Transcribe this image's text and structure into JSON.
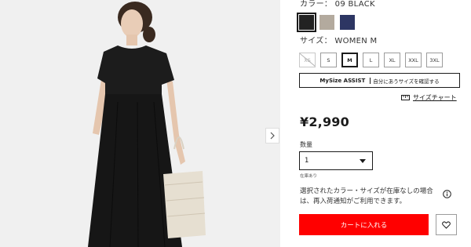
{
  "product": {
    "color_label": "カラー： 09 BLACK",
    "colors": [
      {
        "name": "black",
        "hex": "#222222",
        "selected": true
      },
      {
        "name": "beige",
        "hex": "#b3aa9e",
        "selected": false
      },
      {
        "name": "navy",
        "hex": "#2d3663",
        "selected": false
      }
    ],
    "size_label": "サイズ： WOMEN M",
    "sizes": [
      {
        "label": "XS",
        "state": "unavailable"
      },
      {
        "label": "S",
        "state": "available"
      },
      {
        "label": "M",
        "state": "selected"
      },
      {
        "label": "L",
        "state": "available"
      },
      {
        "label": "XL",
        "state": "available"
      },
      {
        "label": "XXL",
        "state": "available"
      },
      {
        "label": "3XL",
        "state": "available"
      }
    ],
    "mysize": {
      "brand": "MySize ASSIST",
      "text": "自分にあうサイズを確認する"
    },
    "size_chart": "サイズチャート",
    "price": "¥2,990",
    "quantity_label": "数量",
    "quantity_value": "1",
    "stock_status": "在庫あり",
    "notice": "選択されたカラー・サイズが在庫なしの場合は、再入荷通知がご利用できます。",
    "add_to_cart": "カートに入れる"
  },
  "icons": {
    "next": "chevron-right-icon",
    "info": "info-icon",
    "favorite": "heart-icon",
    "size_chart": "ruler-icon"
  },
  "colors": {
    "accent": "#ff0000",
    "text": "#1b1b1b",
    "image_bg": "#f0f0f0"
  }
}
